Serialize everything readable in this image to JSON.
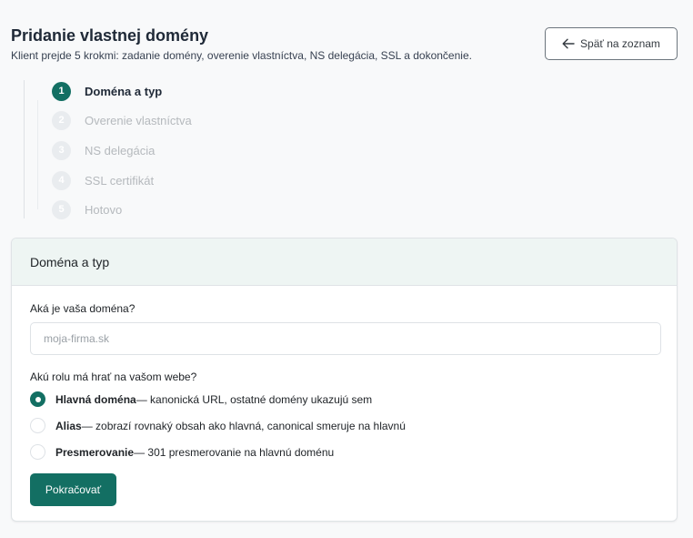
{
  "header": {
    "title": "Pridanie vlastnej domény",
    "subtitle": "Klient prejde 5 krokmi: zadanie domény, overenie vlastníctva, NS delegácia, SSL a dokončenie."
  },
  "back_button": {
    "label": "Späť na zoznam",
    "icon": "arrow-left-icon"
  },
  "steps": [
    {
      "number": "1",
      "label": "Doména a typ",
      "active": true
    },
    {
      "number": "2",
      "label": "Overenie vlastníctva",
      "active": false
    },
    {
      "number": "3",
      "label": "NS delegácia",
      "active": false
    },
    {
      "number": "4",
      "label": "SSL certifikát",
      "active": false
    },
    {
      "number": "5",
      "label": "Hotovo",
      "active": false
    }
  ],
  "card": {
    "title": "Doména a typ",
    "domain_label": "Aká je vaša doména?",
    "domain_placeholder": "moja-firma.sk",
    "domain_value": "",
    "role_label": "Akú rolu má hrať na vašom webe?",
    "options": [
      {
        "title": "Hlavná doména",
        "description": " — kanonická URL, ostatné domény ukazujú sem",
        "checked": true
      },
      {
        "title": "Alias",
        "description": " — zobrazí rovnaký obsah ako hlavná, canonical smeruje na hlavnú",
        "checked": false
      },
      {
        "title": "Presmerovanie",
        "description": " — 301 presmerovanie na hlavnú doménu",
        "checked": false
      }
    ],
    "continue_label": "Pokračovať"
  },
  "colors": {
    "accent": "#136f63",
    "card_header_bg": "#eef5f3",
    "inactive_step": "#e9ecef"
  }
}
